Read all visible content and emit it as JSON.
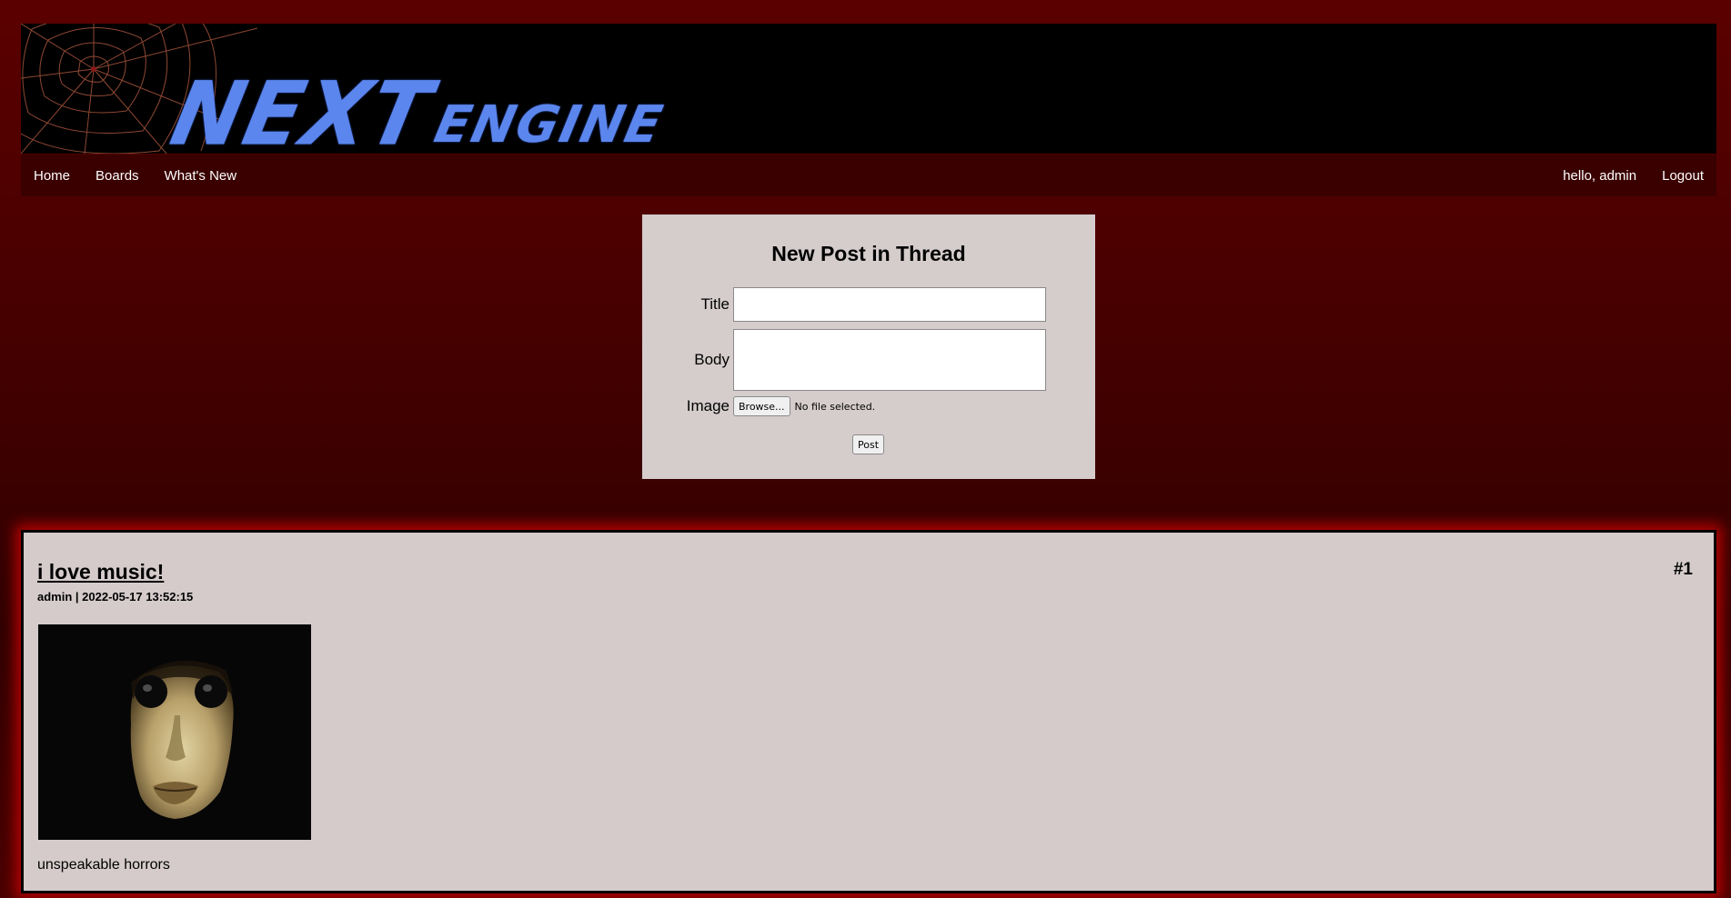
{
  "header": {
    "logo_primary": "NEXT",
    "logo_secondary": "ENGINE"
  },
  "nav": {
    "links": [
      {
        "label": "Home"
      },
      {
        "label": "Boards"
      },
      {
        "label": "What's New"
      }
    ],
    "greeting": "hello, admin",
    "logout_label": "Logout"
  },
  "new_post_form": {
    "heading": "New Post in Thread",
    "title_label": "Title",
    "title_value": "",
    "body_label": "Body",
    "body_value": "",
    "image_label": "Image",
    "browse_label": "Browse...",
    "file_status": "No file selected.",
    "submit_label": "Post"
  },
  "posts": [
    {
      "title": "i love music!",
      "number": "#1",
      "meta": "admin | 2022-05-17 13:52:15",
      "body": "unspeakable horrors"
    }
  ],
  "colors": {
    "page_background": "#4a0000",
    "navbar": "#3a0000",
    "panel": "#d5cccc",
    "logo": "#5b86ee",
    "post_glow": "#b30000"
  }
}
